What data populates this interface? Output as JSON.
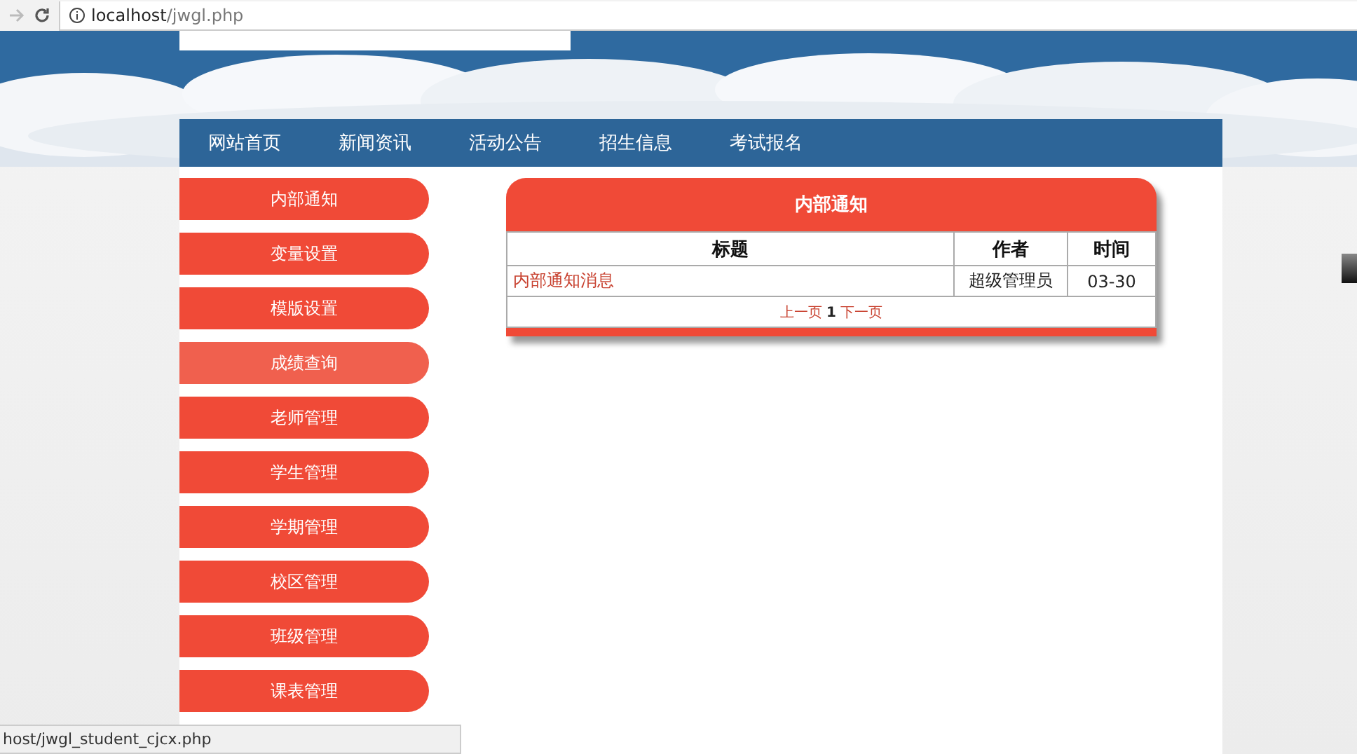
{
  "browser": {
    "url_host": "localhost",
    "url_path": "/jwgl.php"
  },
  "nav": {
    "items": [
      "网站首页",
      "新闻资讯",
      "活动公告",
      "招生信息",
      "考试报名"
    ]
  },
  "sidebar": {
    "items": [
      {
        "label": "内部通知",
        "hovered": false
      },
      {
        "label": "变量设置",
        "hovered": false
      },
      {
        "label": "模版设置",
        "hovered": false
      },
      {
        "label": "成绩查询",
        "hovered": true
      },
      {
        "label": "老师管理",
        "hovered": false
      },
      {
        "label": "学生管理",
        "hovered": false
      },
      {
        "label": "学期管理",
        "hovered": false
      },
      {
        "label": "校区管理",
        "hovered": false
      },
      {
        "label": "班级管理",
        "hovered": false
      },
      {
        "label": "课表管理",
        "hovered": false
      }
    ]
  },
  "panel": {
    "title": "内部通知",
    "columns": [
      "标题",
      "作者",
      "时间"
    ],
    "rows": [
      [
        "内部通知消息",
        "超级管理员",
        "03-30"
      ]
    ],
    "pager": {
      "prev": "上一页",
      "page": "1",
      "next": "下一页"
    }
  },
  "status_bar": "host/jwgl_student_cjcx.php"
}
